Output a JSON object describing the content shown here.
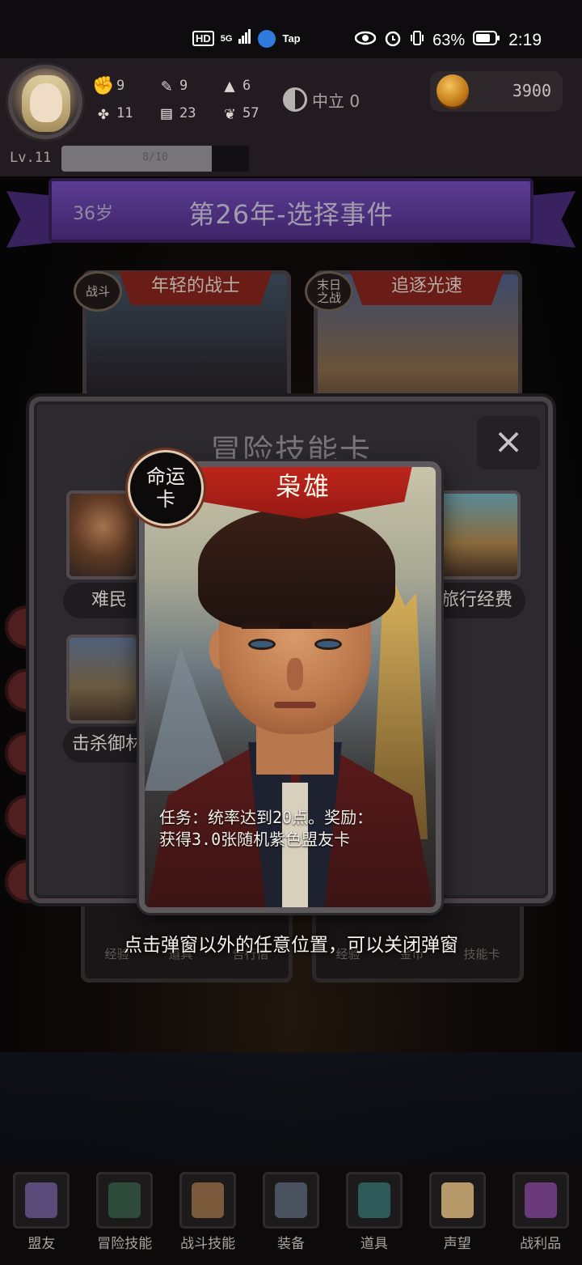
{
  "statusbar": {
    "net_chip": "HD",
    "signal": "5G",
    "tap_label": "Tap",
    "battery": "63%",
    "time": "2:19"
  },
  "player": {
    "stats_top": [
      "9",
      "9",
      "6"
    ],
    "stats_bottom": [
      "11",
      "23",
      "57"
    ],
    "alignment": "中立 0",
    "gold": "3900",
    "level": "Lv.11",
    "xp_text": "8/10",
    "xp_fraction": 0.8
  },
  "banner": {
    "age": "36岁",
    "title": "第26年-选择事件"
  },
  "events": [
    {
      "tag": "战斗",
      "title": "年轻的战士",
      "rewards": [
        "经验",
        "道具",
        "告行借"
      ]
    },
    {
      "tag": "末日之战",
      "title": "追逐光速",
      "rewards": [
        "经验",
        "金币",
        "技能卡"
      ]
    }
  ],
  "dialog": {
    "title": "冒险技能卡",
    "close": "×",
    "cards": [
      "难民",
      "击杀御林",
      "旅行经费"
    ]
  },
  "fate_card": {
    "badge": "命运卡",
    "name": "枭雄",
    "description_line1": "任务：统率达到20点。奖励：",
    "description_line2": "获得3.0张随机紫色盟友卡"
  },
  "hint": "点击弹窗以外的任意位置，可以关闭弹窗",
  "nav": [
    {
      "label": "盟友",
      "icon": "handshake-icon",
      "color": "#5a4a7a"
    },
    {
      "label": "冒险技能",
      "icon": "book-icon",
      "color": "#2e4a3a"
    },
    {
      "label": "战斗技能",
      "icon": "bag-icon",
      "color": "#7a5a3a"
    },
    {
      "label": "装备",
      "icon": "crossed-swords-icon",
      "color": "#4a5260"
    },
    {
      "label": "道具",
      "icon": "potion-bag-icon",
      "color": "#2e5a5a"
    },
    {
      "label": "声望",
      "icon": "scroll-icon",
      "color": "#b89a6a"
    },
    {
      "label": "战利品",
      "icon": "treasure-chest-icon",
      "color": "#6a3a7a"
    }
  ]
}
